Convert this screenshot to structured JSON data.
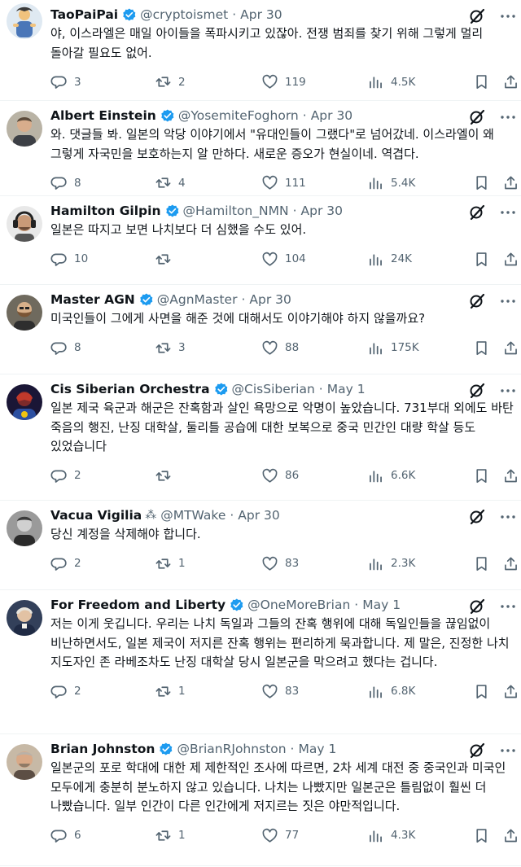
{
  "colors": {
    "text": "#0f1419",
    "muted": "#536471",
    "verified": "#1d9bf0",
    "divider": "#eff3f4"
  },
  "icons": {
    "verified": "verified-badge-icon",
    "grok": "grok-icon",
    "more": "more-options-icon",
    "reply": "reply-icon",
    "retweet": "retweet-icon",
    "like": "like-icon",
    "views": "views-icon",
    "bookmark": "bookmark-icon",
    "share": "share-icon"
  },
  "tweets": [
    {
      "name": "TaoPaiPai",
      "verified": true,
      "handle": "@cryptoismet",
      "time": "Apr 30",
      "text": "야, 이스라엘은 매일 아이들을 폭파시키고 있잖아. 전쟁 범죄를 찾기 위해 그렇게 멀리 돌아갈 필요도 없어.",
      "replies": "3",
      "retweets": "2",
      "likes": "119",
      "views": "4.5K",
      "avatar": "cartoon-figure"
    },
    {
      "name": "Albert Einstein",
      "verified": true,
      "handle": "@YosemiteFoghorn",
      "time": "Apr 30",
      "text": "와. 댓글들 봐. 일본의 악당 이야기에서 \"유대인들이 그랬다\"로 넘어갔네. 이스라엘이 왜 그렇게 자국민을 보호하는지 알 만하다. 새로운 증오가 현실이네. 역겹다.",
      "replies": "8",
      "retweets": "4",
      "likes": "111",
      "views": "5.4K",
      "avatar": "man-photo"
    },
    {
      "name": "Hamilton Gilpin",
      "verified": true,
      "handle": "@Hamilton_NMN",
      "time": "Apr 30",
      "text": "일본은 따지고 보면 나치보다 더 심했을 수도 있어.",
      "replies": "10",
      "retweets": "",
      "likes": "104",
      "views": "24K",
      "avatar": "headphones-man"
    },
    {
      "name": "Master AGN",
      "verified": true,
      "handle": "@AgnMaster",
      "time": "Apr 30",
      "text": "미국인들이 그에게 사면을 해준 것에 대해서도 이야기해야 하지 않을까요?",
      "replies": "8",
      "retweets": "3",
      "likes": "88",
      "views": "175K",
      "avatar": "bearded-man"
    },
    {
      "name": "Cis Siberian Orchestra",
      "verified": true,
      "handle": "@CisSiberian",
      "time": "May 1",
      "text": "일본 제국 육군과 해군은 잔혹함과 살인 욕망으로 악명이 높았습니다. 731부대 외에도 바탄 죽음의 행진, 난징 대학살, 둘리틀 공습에 대한 보복으로 중국 민간인 대량 학살 등도 있었습니다",
      "replies": "2",
      "retweets": "",
      "likes": "86",
      "views": "6.6K",
      "avatar": "superhero"
    },
    {
      "name": "Vacua Vigilia",
      "verified": false,
      "sparkle": "⁂",
      "handle": "@MTWake",
      "time": "Apr 30",
      "text": "당신 계정을 삭제해야 합니다.",
      "replies": "2",
      "retweets": "1",
      "likes": "83",
      "views": "2.3K",
      "avatar": "bw-portrait"
    },
    {
      "name": "For Freedom and Liberty",
      "verified": true,
      "handle": "@OneMoreBrian",
      "time": "May 1",
      "text": "저는 이게 웃깁니다. 우리는 나치 독일과 그들의 잔혹 행위에 대해 독일인들을 끊임없이 비난하면서도, 일본 제국이 저지른 잔혹 행위는 편리하게 묵과합니다. 제 말은, 진정한 나치 지도자인 존 라베조차도 난징 대학살 당시 일본군을 막으려고 했다는 겁니다.",
      "replies": "2",
      "retweets": "1",
      "likes": "83",
      "views": "6.8K",
      "avatar": "painted-portrait"
    },
    {
      "name": "Brian Johnston",
      "verified": true,
      "handle": "@BrianRJohnston",
      "time": "May 1",
      "text": "일본군의 포로 학대에 대한 제 제한적인 조사에 따르면, 2차 세계 대전 중 중국인과 미국인 모두에게 충분히 분노하지 않고 있습니다. 나치는 나빴지만 일본군은 틀림없이 훨씬 더 나빴습니다. 일부 인간이 다른 인간에게 저지르는 짓은 야만적입니다.",
      "replies": "6",
      "retweets": "1",
      "likes": "77",
      "views": "4.3K",
      "avatar": "older-man"
    }
  ]
}
